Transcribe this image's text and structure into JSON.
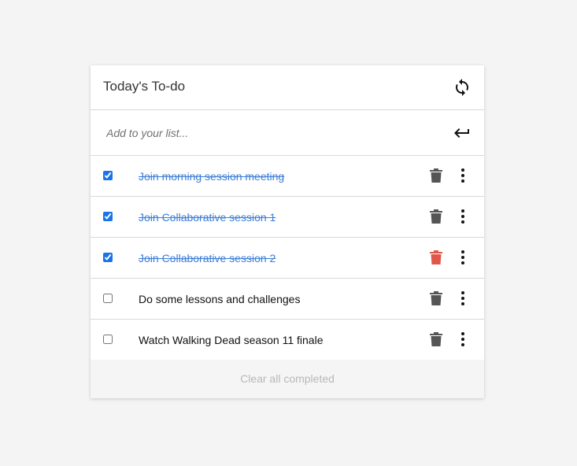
{
  "header": {
    "title": "Today's To-do",
    "refresh_icon": "refresh-icon"
  },
  "add_input": {
    "placeholder": "Add to your list...",
    "value": "",
    "enter_icon": "enter-return-icon"
  },
  "todos": [
    {
      "label": "Join morning session meeting",
      "completed": true,
      "trash_color": "#555555"
    },
    {
      "label": "Join Collaborative session 1",
      "completed": true,
      "trash_color": "#555555"
    },
    {
      "label": "Join Collaborative session 2",
      "completed": true,
      "trash_color": "#e0574a"
    },
    {
      "label": "Do some lessons and challenges",
      "completed": false,
      "trash_color": "#555555"
    },
    {
      "label": "Watch Walking Dead season 11 finale",
      "completed": false,
      "trash_color": "#555555"
    }
  ],
  "footer": {
    "clear_label": "Clear all completed"
  },
  "colors": {
    "accent": "#1a73e8",
    "completed_text": "#3b7dd8",
    "trash_default": "#555555",
    "trash_hover": "#e0574a"
  }
}
